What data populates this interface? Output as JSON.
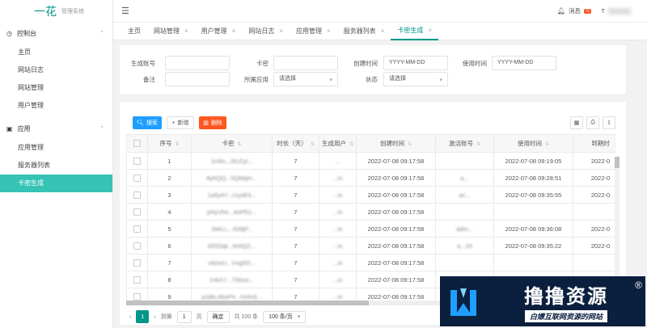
{
  "app": {
    "logo": "一花",
    "subtitle": "管理系统"
  },
  "sidebar": {
    "groups": [
      {
        "label": "控制台",
        "items": [
          "主页",
          "网站日志",
          "网站管理",
          "用户管理"
        ]
      },
      {
        "label": "应用",
        "items": [
          "应用管理",
          "服务器列表",
          "卡密生成"
        ]
      }
    ],
    "active": "卡密生成"
  },
  "header": {
    "msg_label": "消息",
    "msg_count": "0",
    "user": "T"
  },
  "tabs": [
    "主页",
    "网站管理",
    "用户管理",
    "网站日志",
    "应用管理",
    "服务器列表",
    "卡密生成"
  ],
  "active_tab": "卡密生成",
  "search": {
    "gen_account_label": "生成账号",
    "card_label": "卡密",
    "create_time_label": "创建时间",
    "create_time_placeholder": "YYYY-MM-DD",
    "use_time_label": "使用时间",
    "use_time_placeholder": "YYYY-MM-DD",
    "note_label": "备注",
    "app_label": "所属应用",
    "app_select": "请选择",
    "status_label": "状态",
    "status_select": "请选择"
  },
  "toolbar": {
    "search": "搜索",
    "add": "新增",
    "delete": "删除"
  },
  "table": {
    "headers": [
      "序号",
      "卡密",
      "时长（天）",
      "生成用户",
      "创建时间",
      "激活账号",
      "使用时间",
      "到期时"
    ],
    "rows": [
      [
        "1",
        "1m6v...2lUZyl...",
        "7",
        "...",
        "2022-07-08 09:17:58",
        "",
        "2022-07-08 09:19:05",
        "2022-0"
      ],
      [
        "2",
        "8yhQQ...hQMqH...",
        "7",
        "...in",
        "2022-07-08 09:17:58",
        "a...",
        "2022-07-08 09:28:51",
        "2022-0"
      ],
      [
        "3",
        "1a5y4Y...r1ysE4...",
        "7",
        "...in",
        "2022-07-08 09:17:58",
        "ac...",
        "2022-07-08 09:35:55",
        "2022-0"
      ],
      [
        "4",
        "pHyVhe...4oPEz...",
        "7",
        "...in",
        "2022-07-08 09:17:58",
        "",
        "",
        ""
      ],
      [
        "5",
        "J9ALL...939jP...",
        "7",
        "...in",
        "2022-07-08 09:17:58",
        "adm...",
        "2022-07-08 09:36:08",
        "2022-0"
      ],
      [
        "6",
        "Af2Oqk...kNIQZ...",
        "7",
        "...in",
        "2022-07-08 09:17:58",
        "a...33",
        "2022-07-08 09:35:22",
        "2022-0"
      ],
      [
        "7",
        "o9zwU...Vxg5O...",
        "7",
        "...in",
        "2022-07-08 09:17:58",
        "",
        "",
        ""
      ],
      [
        "8",
        "1nkX7...70Kox...",
        "7",
        "...in",
        "2022-07-08 09:17:58",
        "",
        "",
        ""
      ],
      [
        "9",
        "pzdkL4boP4...HzlH3...",
        "7",
        "...in",
        "2022-07-08 09:17:58",
        "",
        "",
        ""
      ]
    ]
  },
  "pager": {
    "page": "1",
    "goto_label": "到第",
    "goto_value": "1",
    "page_unit": "页",
    "confirm": "确定",
    "total": "共 100 条",
    "per_page": "100 条/页"
  },
  "watermark": {
    "title": "撸撸资源",
    "subtitle": "白嫖互联网资源的网站",
    "reg": "®"
  },
  "colors": {
    "accent": "#009688",
    "search_btn": "#1e9fff",
    "delete_btn": "#ff5722"
  }
}
